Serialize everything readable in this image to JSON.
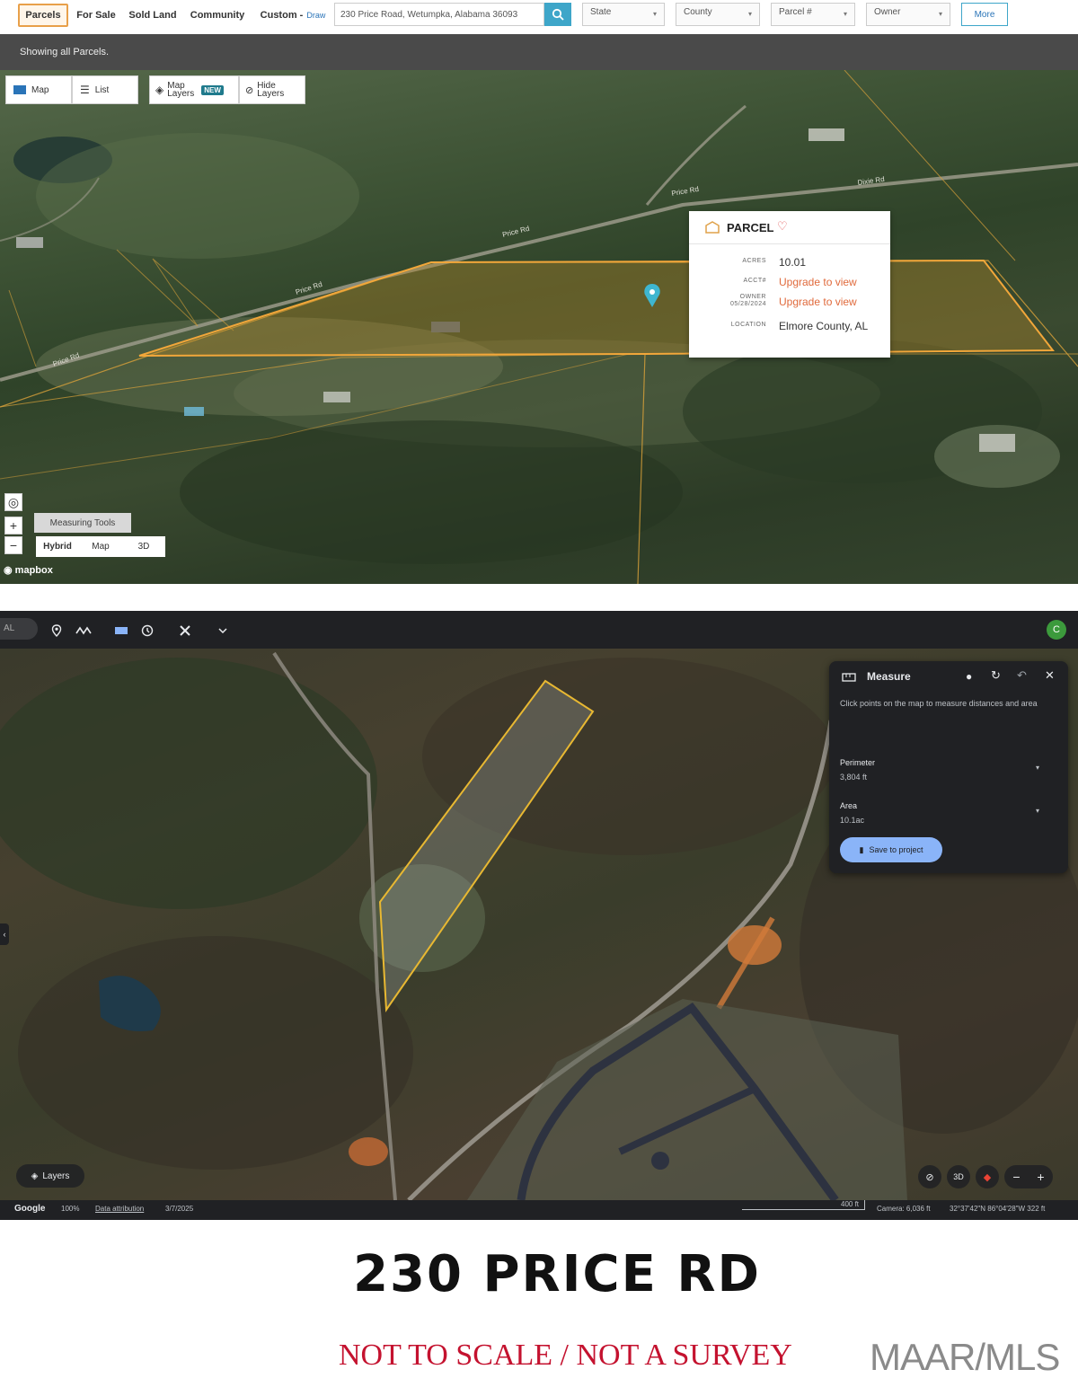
{
  "top_app": {
    "tabs": [
      {
        "label": "Parcels",
        "active": true
      },
      {
        "label": "For Sale"
      },
      {
        "label": "Sold Land"
      },
      {
        "label": "Community"
      },
      {
        "label": "Custom -",
        "sub": "Draw"
      }
    ],
    "search": {
      "value": "230 Price Road, Wetumpka, Alabama 36093"
    },
    "filters": {
      "state": "State",
      "county": "County",
      "parcel": "Parcel #",
      "owner": "Owner"
    },
    "more_label": "More",
    "status_text": "Showing all Parcels.",
    "view_toggle": {
      "map": "Map",
      "list": "List"
    },
    "layers": {
      "map_layers": "Map Layers",
      "new_badge": "NEW",
      "hide_layers": "Hide Layers"
    },
    "popup": {
      "title": "PARCEL",
      "rows": [
        {
          "key": "ACRES",
          "value": "10.01",
          "link": false
        },
        {
          "key": "ACCT#",
          "value": "Upgrade to view",
          "link": true
        },
        {
          "key": "OWNER 05/28/2024",
          "value": "Upgrade to view",
          "link": true
        },
        {
          "key": "LOCATION",
          "value": "Elmore County, AL",
          "link": false
        }
      ]
    },
    "road_labels": [
      "Price Rd",
      "Price Rd",
      "Price Rd",
      "Price Rd",
      "Dixie Rd"
    ],
    "controls": {
      "measuring": "Measuring Tools",
      "modes": [
        "Hybrid",
        "Map",
        "3D"
      ],
      "zoom_in": "+",
      "zoom_out": "−"
    },
    "attribution": "mapbox"
  },
  "google_earth": {
    "search_text": "AL",
    "avatar_letter": "C",
    "measure": {
      "title": "Measure",
      "hint": "Click points on the map to measure distances and area",
      "perimeter_label": "Perimeter",
      "perimeter_value": "3,804 ft",
      "area_label": "Area",
      "area_value": "10.1ac",
      "save_label": "Save to project"
    },
    "layers_label": "Layers",
    "view_3d": "3D",
    "footer": {
      "brand": "Google",
      "zoom": "100%",
      "data": "Data attribution",
      "date": "3/7/2025",
      "scale": "400 ft",
      "camera": "Camera: 6,036 ft",
      "coords": "32°37'42\"N 86°04'28\"W 322 ft"
    }
  },
  "caption": {
    "title": "230 PRICE RD",
    "note": "NOT TO SCALE / NOT A SURVEY",
    "source": "MAAR/MLS"
  }
}
